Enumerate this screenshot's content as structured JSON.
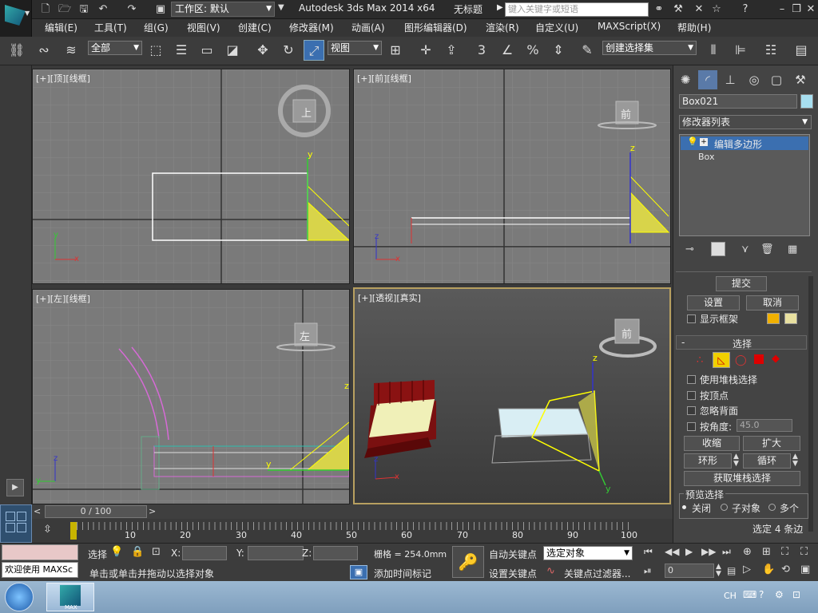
{
  "title_bar": {
    "workspace_label": "工作区: 默认",
    "app_title": "Autodesk 3ds Max  2014 x64",
    "document_title": "无标题",
    "search_placeholder": "键入关键字或短语"
  },
  "menu": [
    "编辑(E)",
    "工具(T)",
    "组(G)",
    "视图(V)",
    "创建(C)",
    "修改器(M)",
    "动画(A)",
    "图形编辑器(D)",
    "渲染(R)",
    "自定义(U)",
    "MAXScript(X)",
    "帮助(H)"
  ],
  "toolbar": {
    "selection_filter": "全部",
    "reference_coord": "视图",
    "angle_snap_label": "3",
    "named_selection_set": "创建选择集"
  },
  "viewports": {
    "top": {
      "label": "[+][顶][线框]",
      "cube_face": "上"
    },
    "front": {
      "label": "[+][前][线框]",
      "cube_face": "前"
    },
    "left": {
      "label": "[+][左][线框]",
      "cube_face": "左"
    },
    "perspective": {
      "label": "[+][透视][真实]",
      "cube_face": "前"
    }
  },
  "axes": {
    "x": "x",
    "y": "y",
    "z": "z"
  },
  "command_panel": {
    "object_name": "Box021",
    "object_color": "#a8dff0",
    "modifier_list_label": "修改器列表",
    "stack": [
      {
        "label": "编辑多边形",
        "selected": true
      },
      {
        "label": "Box",
        "selected": false
      }
    ],
    "commit_label": "提交",
    "settings_label": "设置",
    "cancel_label": "取消",
    "show_cage_label": "显示框架",
    "cage_colors": [
      "#f0b000",
      "#e8e0a0"
    ],
    "rollout_selection_title": "选择",
    "rollout_minus": "-",
    "use_stack_selection_label": "使用堆栈选择",
    "by_vertex_label": "按顶点",
    "ignore_backfacing_label": "忽略背面",
    "by_angle_label": "按角度:",
    "by_angle_value": "45.0",
    "shrink_label": "收缩",
    "grow_label": "扩大",
    "ring_label": "环形",
    "loop_label": "循环",
    "get_stack_selection_label": "获取堆栈选择",
    "preview_selection_title": "预览选择",
    "preview_options": [
      "关闭",
      "子对象",
      "多个"
    ],
    "selected_status": "选定 4 条边"
  },
  "timeline": {
    "frame_display": "0 / 100",
    "ticks": [
      "10",
      "20",
      "30",
      "40",
      "50",
      "60",
      "70",
      "80",
      "90",
      "100"
    ]
  },
  "status": {
    "maxscript_prompt": "欢迎使用  MAXSc",
    "selection_label": "选择",
    "x_label": "X:",
    "y_label": "Y:",
    "z_label": "Z:",
    "grid_label": "栅格 = 254.0mm",
    "prompt_message": "单击或单击并拖动以选择对象",
    "add_time_tag": "添加时间标记",
    "auto_key": "自动关键点",
    "set_key": "设置关键点",
    "key_mode": "选定对象",
    "key_filters": "关键点过滤器...",
    "current_frame": "0"
  },
  "taskbar": {
    "language": "CH",
    "app_label": "MAX"
  }
}
